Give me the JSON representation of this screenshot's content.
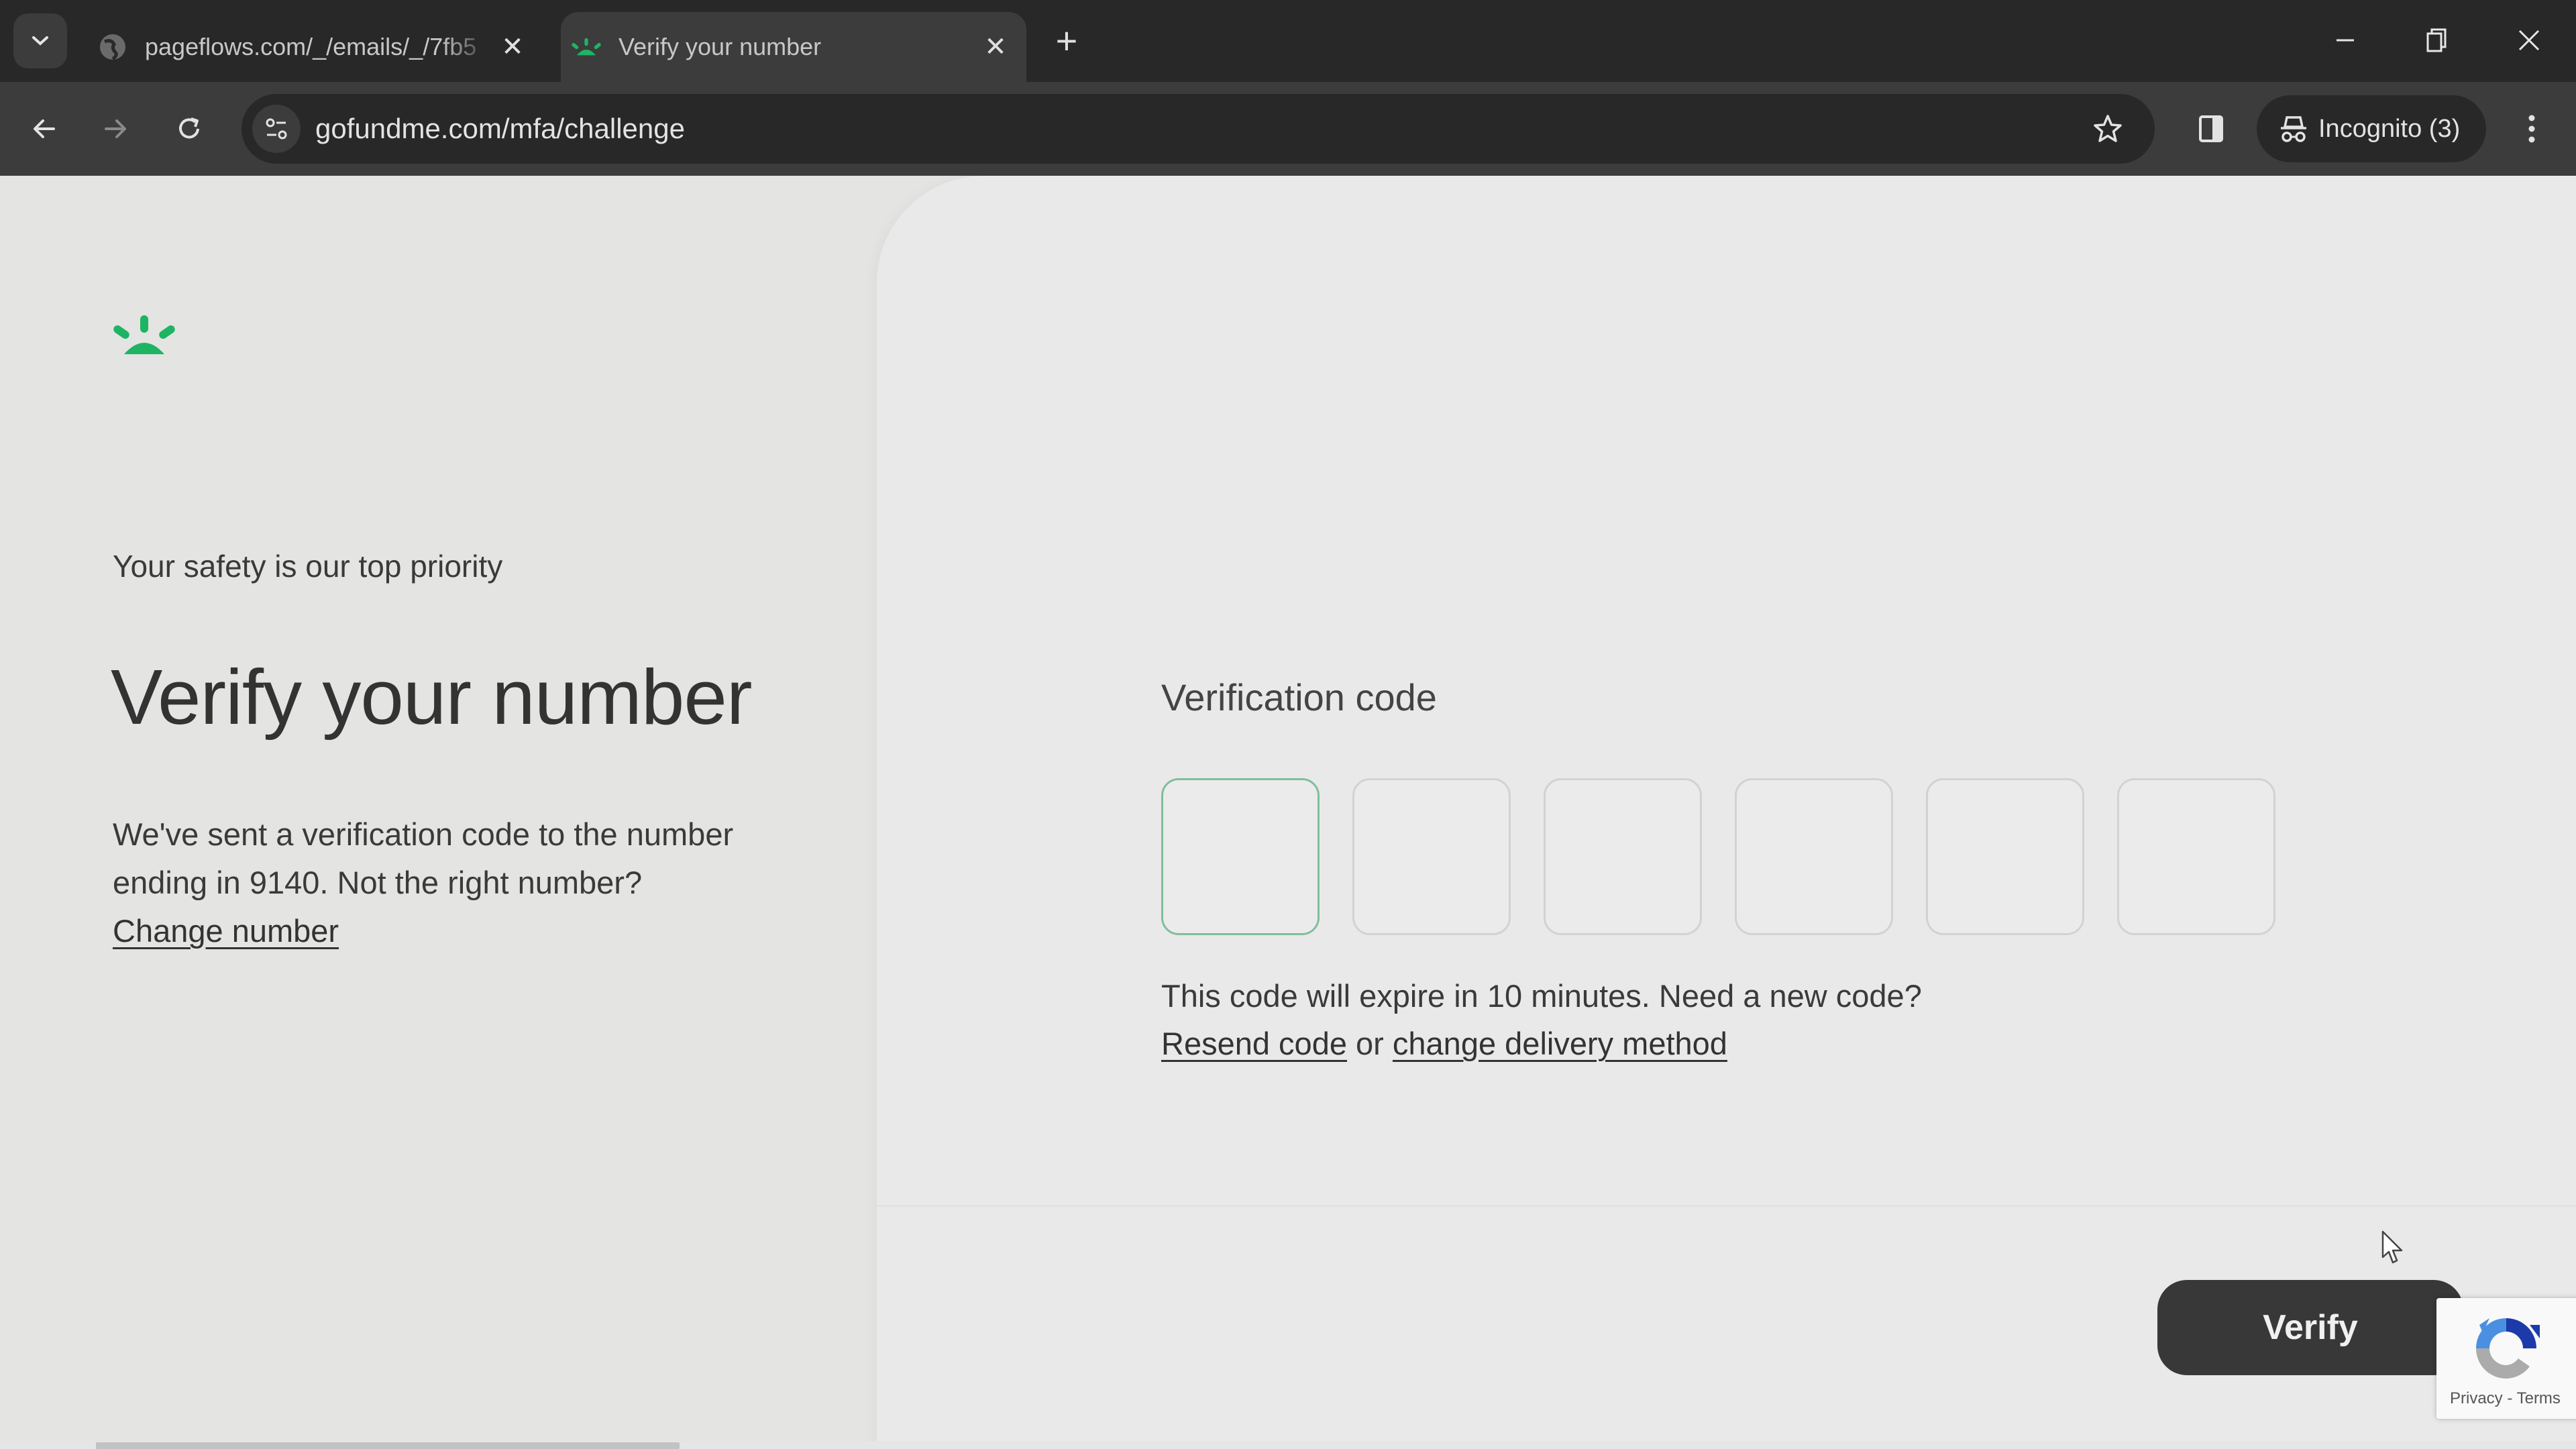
{
  "browser": {
    "tabs": [
      {
        "title": "pageflows.com/_/emails/_/7fb5",
        "favicon": "globe-icon",
        "active": false
      },
      {
        "title": "Verify your number",
        "favicon": "gofundme-logo-icon",
        "active": true
      }
    ],
    "url": "gofundme.com/mfa/challenge",
    "incognito_label": "Incognito (3)",
    "icons": {
      "tab_search": "chevron-down-icon",
      "close_tab": "close-icon",
      "new_tab": "plus-icon",
      "back": "arrow-left-icon",
      "forward": "arrow-right-icon",
      "reload": "reload-icon",
      "site_info": "tune-icon",
      "bookmark": "star-icon",
      "side_panel": "side-panel-icon",
      "incognito": "incognito-icon",
      "menu": "more-vert-icon",
      "minimize": "minimize-icon",
      "restore": "restore-icon",
      "close_window": "close-icon"
    },
    "glyphs": {
      "close": "✕",
      "plus": "+"
    }
  },
  "page": {
    "brand_color": "#1eb464",
    "left": {
      "eyebrow": "Your safety is our top priority",
      "heading": "Verify your number",
      "description": "We've sent a verification code to the number ending in 9140. Not the right number?",
      "change_number_link": "Change number"
    },
    "form": {
      "label": "Verification code",
      "code_digits": [
        "",
        "",
        "",
        "",
        "",
        ""
      ],
      "focused_index": 0,
      "expire_text": "This code will expire in 10 minutes. Need a new code?",
      "resend_link": "Resend code",
      "or_text": " or ",
      "change_delivery_link": "change delivery method",
      "submit_label": "Verify"
    },
    "recaptcha": {
      "privacy": "Privacy",
      "separator": " - ",
      "terms": "Terms"
    }
  }
}
